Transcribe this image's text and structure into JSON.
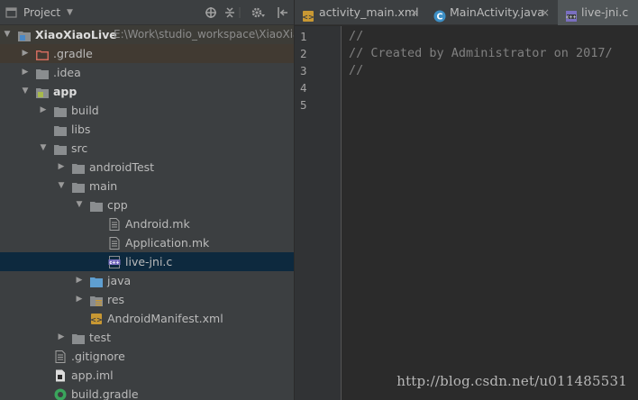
{
  "project_panel": {
    "title": "Project",
    "toolbar_icons": [
      "target-icon",
      "collapse-icon",
      "gear-icon",
      "hide-icon"
    ]
  },
  "tree": {
    "items": [
      {
        "label": "XiaoXiaoLive",
        "path": "E:\\Work\\studio_workspace\\XiaoXiaoLive",
        "kind": "root",
        "expanded": true
      },
      {
        "label": ".gradle",
        "kind": "folder-excluded",
        "expanded": false
      },
      {
        "label": ".idea",
        "kind": "folder",
        "expanded": false
      },
      {
        "label": "app",
        "kind": "module",
        "expanded": true
      },
      {
        "label": "build",
        "kind": "folder",
        "expanded": false
      },
      {
        "label": "libs",
        "kind": "folder",
        "expanded": null
      },
      {
        "label": "src",
        "kind": "folder",
        "expanded": true
      },
      {
        "label": "androidTest",
        "kind": "folder",
        "expanded": false
      },
      {
        "label": "main",
        "kind": "folder",
        "expanded": true
      },
      {
        "label": "cpp",
        "kind": "folder",
        "expanded": true
      },
      {
        "label": "Android.mk",
        "kind": "file-text"
      },
      {
        "label": "Application.mk",
        "kind": "file-text"
      },
      {
        "label": "live-jni.c",
        "kind": "file-c",
        "selected": true
      },
      {
        "label": "java",
        "kind": "folder-source",
        "expanded": false
      },
      {
        "label": "res",
        "kind": "folder-res",
        "expanded": false
      },
      {
        "label": "AndroidManifest.xml",
        "kind": "file-xml"
      },
      {
        "label": "test",
        "kind": "folder",
        "expanded": false
      },
      {
        "label": ".gitignore",
        "kind": "file-text"
      },
      {
        "label": "app.iml",
        "kind": "file-iml"
      },
      {
        "label": "build.gradle",
        "kind": "file-gradle"
      }
    ]
  },
  "tabs": [
    {
      "label": "activity_main.xml",
      "icon": "xml-file-icon",
      "close": "×",
      "active": false
    },
    {
      "label": "MainActivity.java",
      "icon": "class-c-icon",
      "close": "×",
      "active": false
    },
    {
      "label": "live-jni.c",
      "icon": "c-file-icon",
      "close": "×",
      "active": true
    }
  ],
  "editor": {
    "line_numbers": [
      "1",
      "2",
      "3",
      "4",
      "5"
    ],
    "lines": [
      "//",
      "// Created by Administrator on 2017/",
      "//",
      "",
      ""
    ]
  },
  "watermark": "http://blog.csdn.net/u011485531",
  "colors": {
    "panel_bg": "#3c3f41",
    "editor_bg": "#2b2b2b",
    "selection": "#0d293e",
    "comment": "#808080",
    "folder": "#8a8d8f",
    "source_folder": "#5f9fd1",
    "excluded_folder": "#d06b5e"
  }
}
